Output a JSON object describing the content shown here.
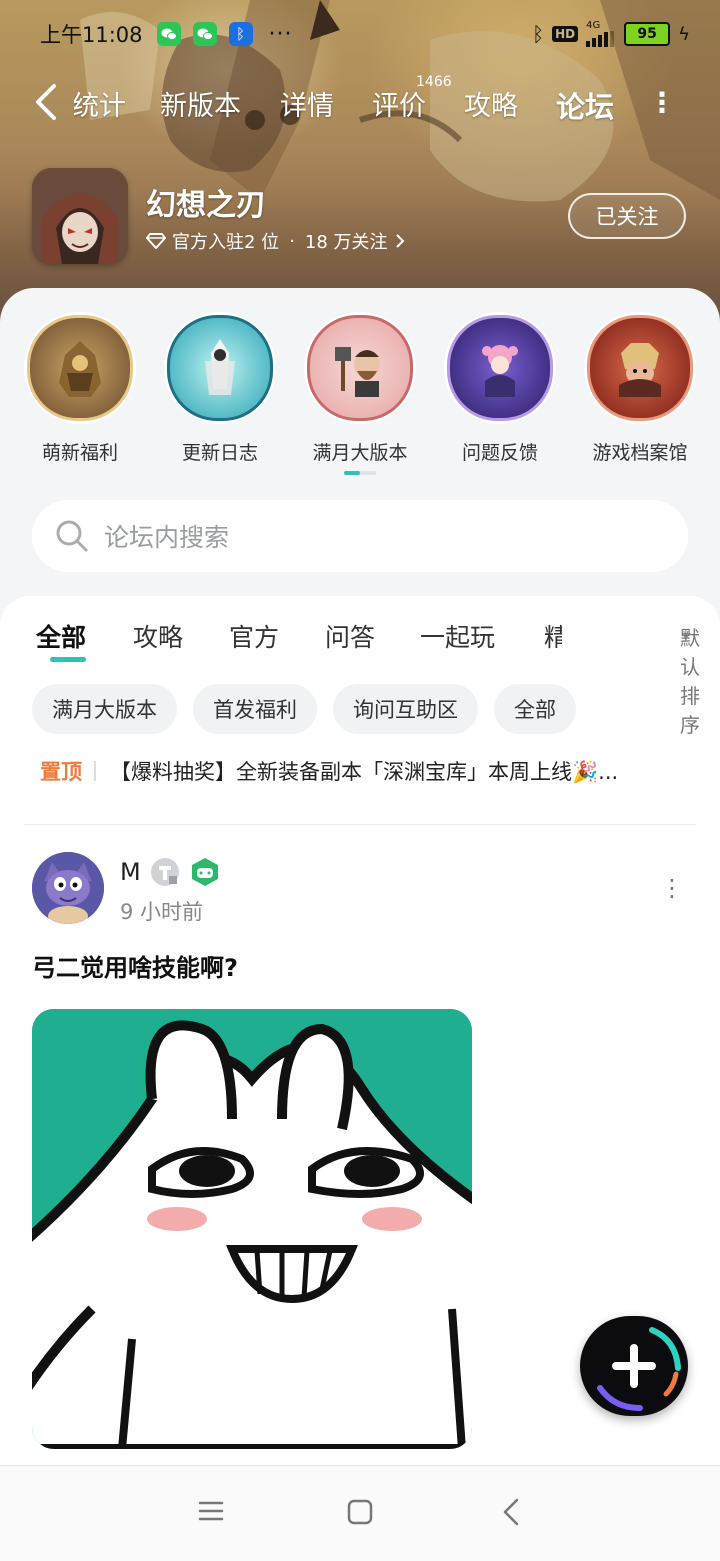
{
  "status_bar": {
    "time": "上午11:08",
    "more": "···",
    "hd": "HD",
    "network": "4G",
    "battery": "95"
  },
  "nav": {
    "tabs": [
      {
        "label": "统计"
      },
      {
        "label": "新版本"
      },
      {
        "label": "详情"
      },
      {
        "label": "评价",
        "badge": "1466"
      },
      {
        "label": "攻略"
      },
      {
        "label": "论坛",
        "active": true
      }
    ],
    "more": "⋮"
  },
  "game": {
    "name": "幻想之刃",
    "official": "官方入驻2 位",
    "followers": "18 万关注",
    "follow_button": "已关注"
  },
  "categories": [
    {
      "label": "萌新福利"
    },
    {
      "label": "更新日志"
    },
    {
      "label": "满月大版本"
    },
    {
      "label": "问题反馈"
    },
    {
      "label": "游戏档案馆"
    }
  ],
  "search": {
    "placeholder": "论坛内搜索"
  },
  "feed_tabs": [
    {
      "label": "全部",
      "active": true
    },
    {
      "label": "攻略"
    },
    {
      "label": "官方"
    },
    {
      "label": "问答"
    },
    {
      "label": "一起玩"
    },
    {
      "label": "精"
    }
  ],
  "sort_label": "默认排序",
  "filter_chips": [
    "满月大版本",
    "首发福利",
    "询问互助区",
    "全部"
  ],
  "pinned": {
    "tag": "置顶",
    "text": "【爆料抽奖】全新装备副本「深渊宝库」本周上线🎉..."
  },
  "post": {
    "user": "M",
    "time": "9 小时前",
    "title": "弓二觉用啥技能啊?",
    "more": "⋮"
  },
  "colors": {
    "accent": "#2cc3b7",
    "pin": "#f07b3f"
  }
}
